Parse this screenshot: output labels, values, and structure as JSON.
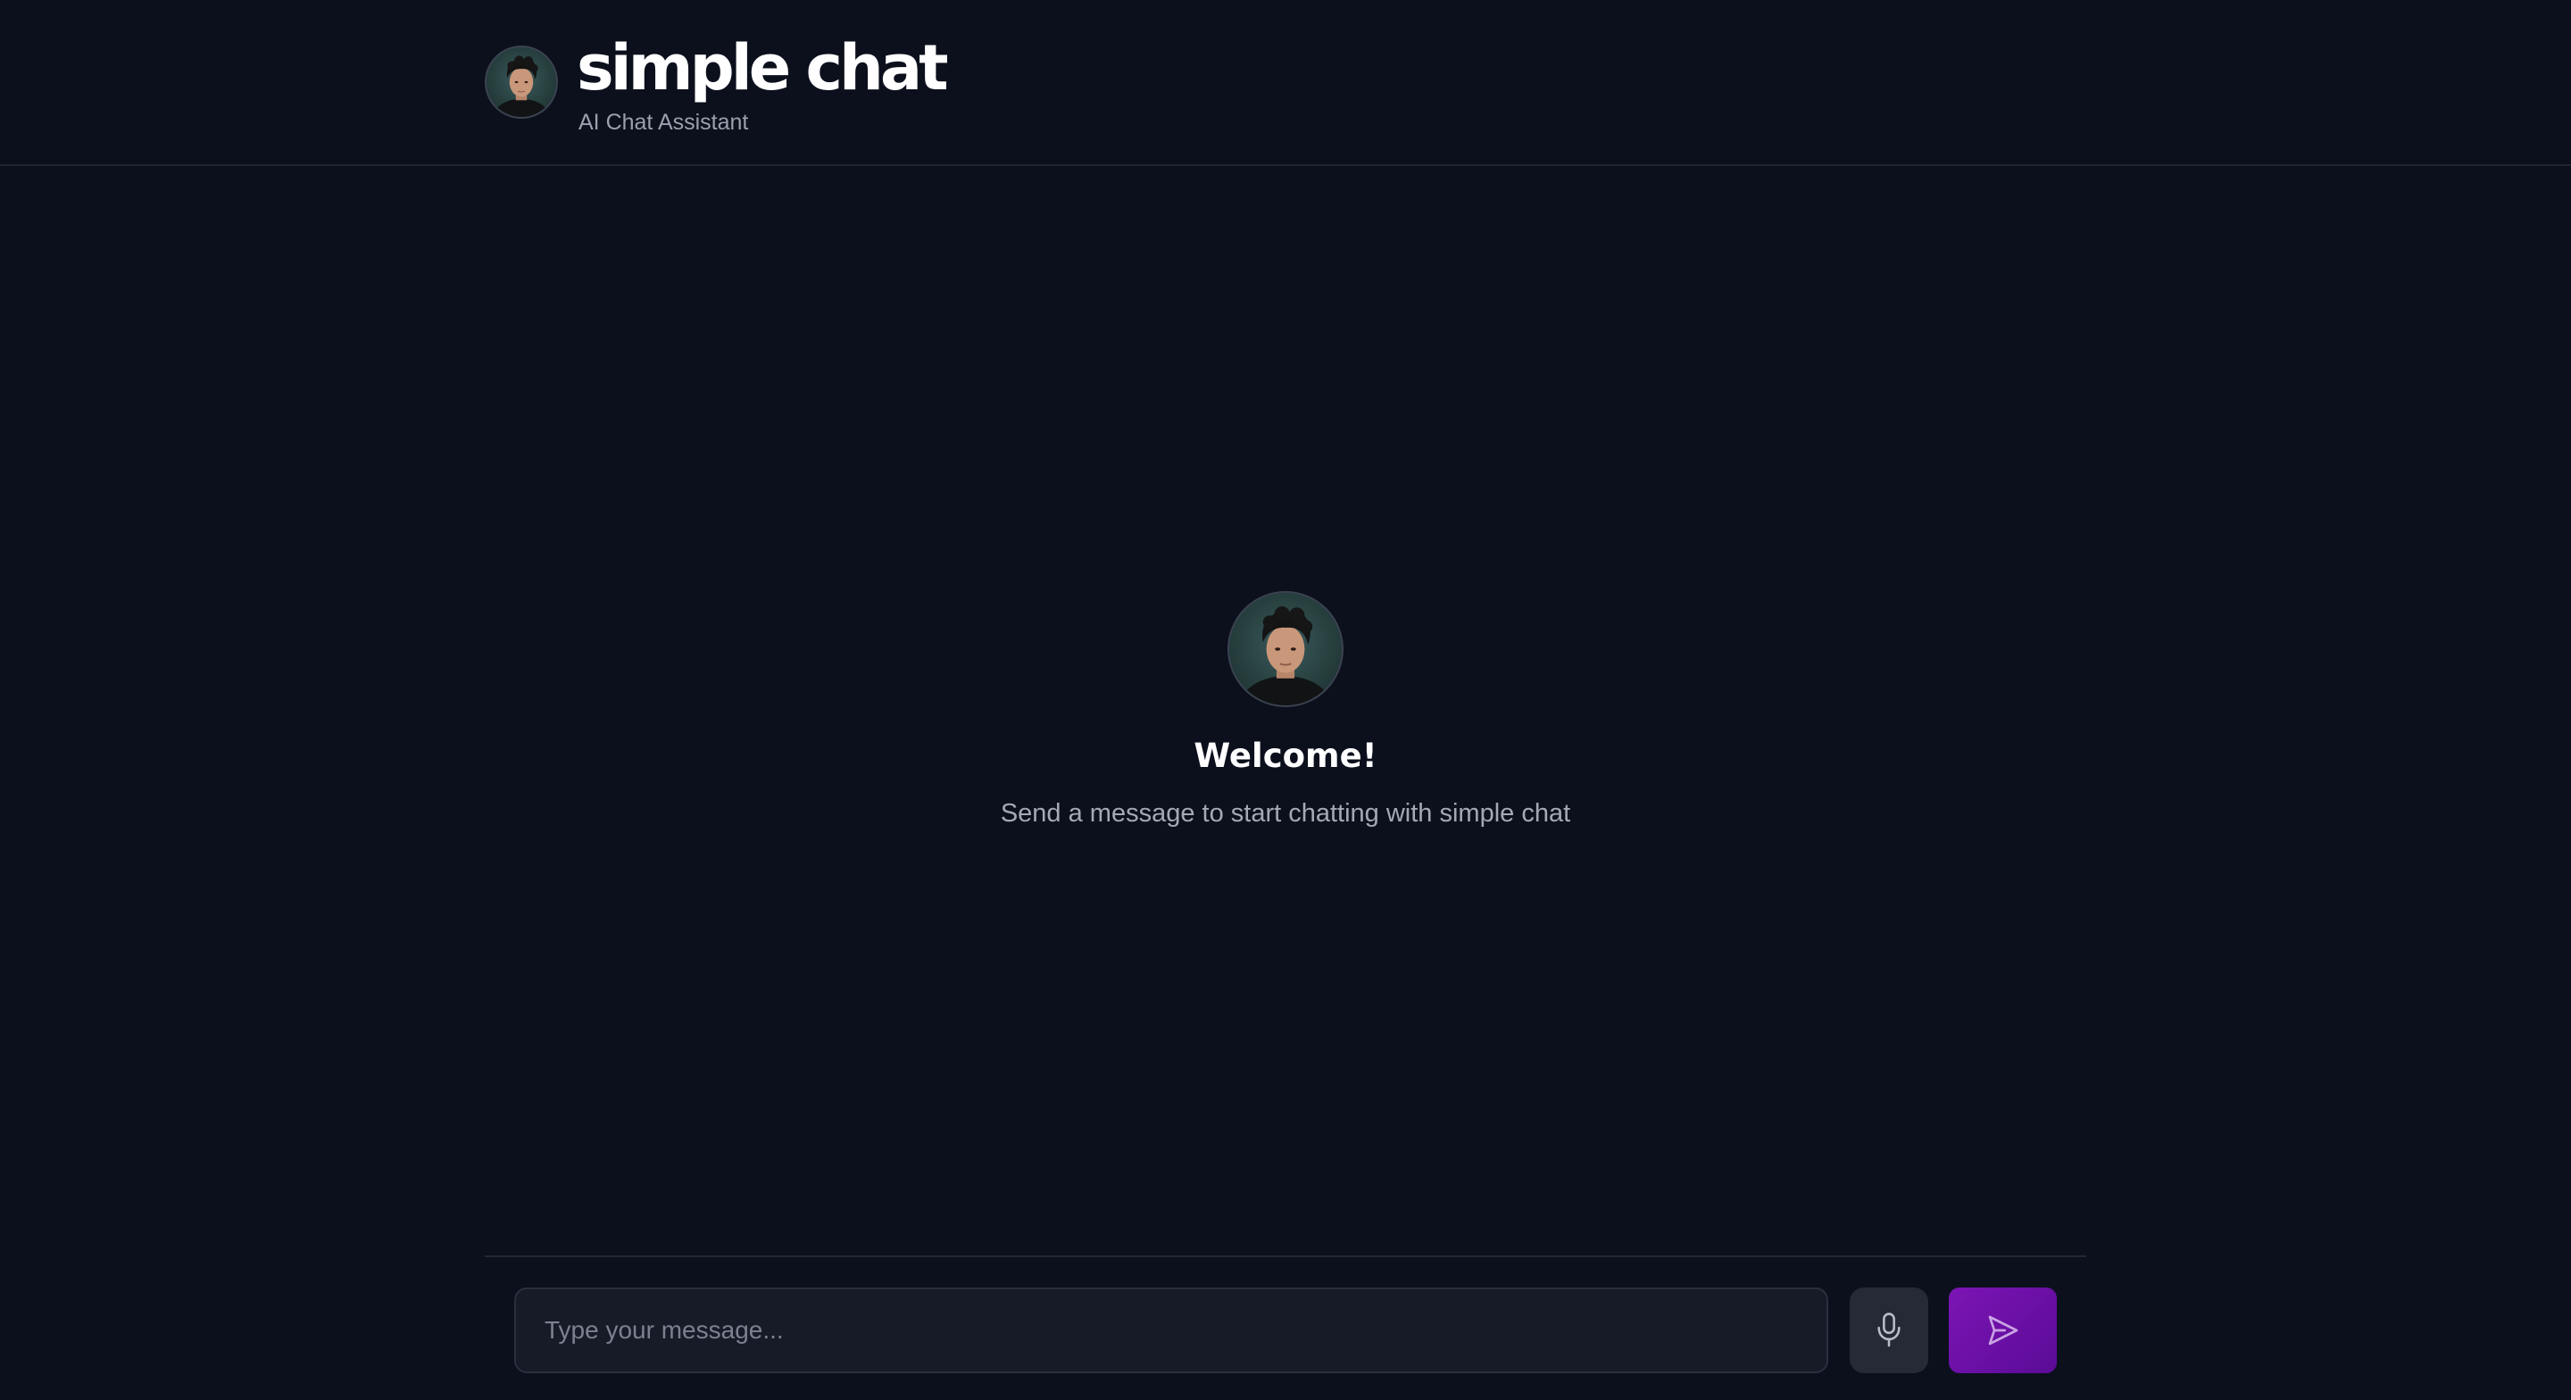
{
  "header": {
    "title": "simple chat",
    "subtitle": "AI Chat Assistant",
    "avatar_icon": "assistant-avatar"
  },
  "welcome": {
    "title": "Welcome!",
    "message": "Send a message to start chatting with simple chat"
  },
  "composer": {
    "placeholder": "Type your message...",
    "mic_icon": "microphone-icon",
    "send_icon": "send-icon"
  },
  "colors": {
    "background": "#0c101d",
    "accent": "#6a10a6",
    "input_bg": "#171b28",
    "muted_text": "#9aa0ad"
  }
}
